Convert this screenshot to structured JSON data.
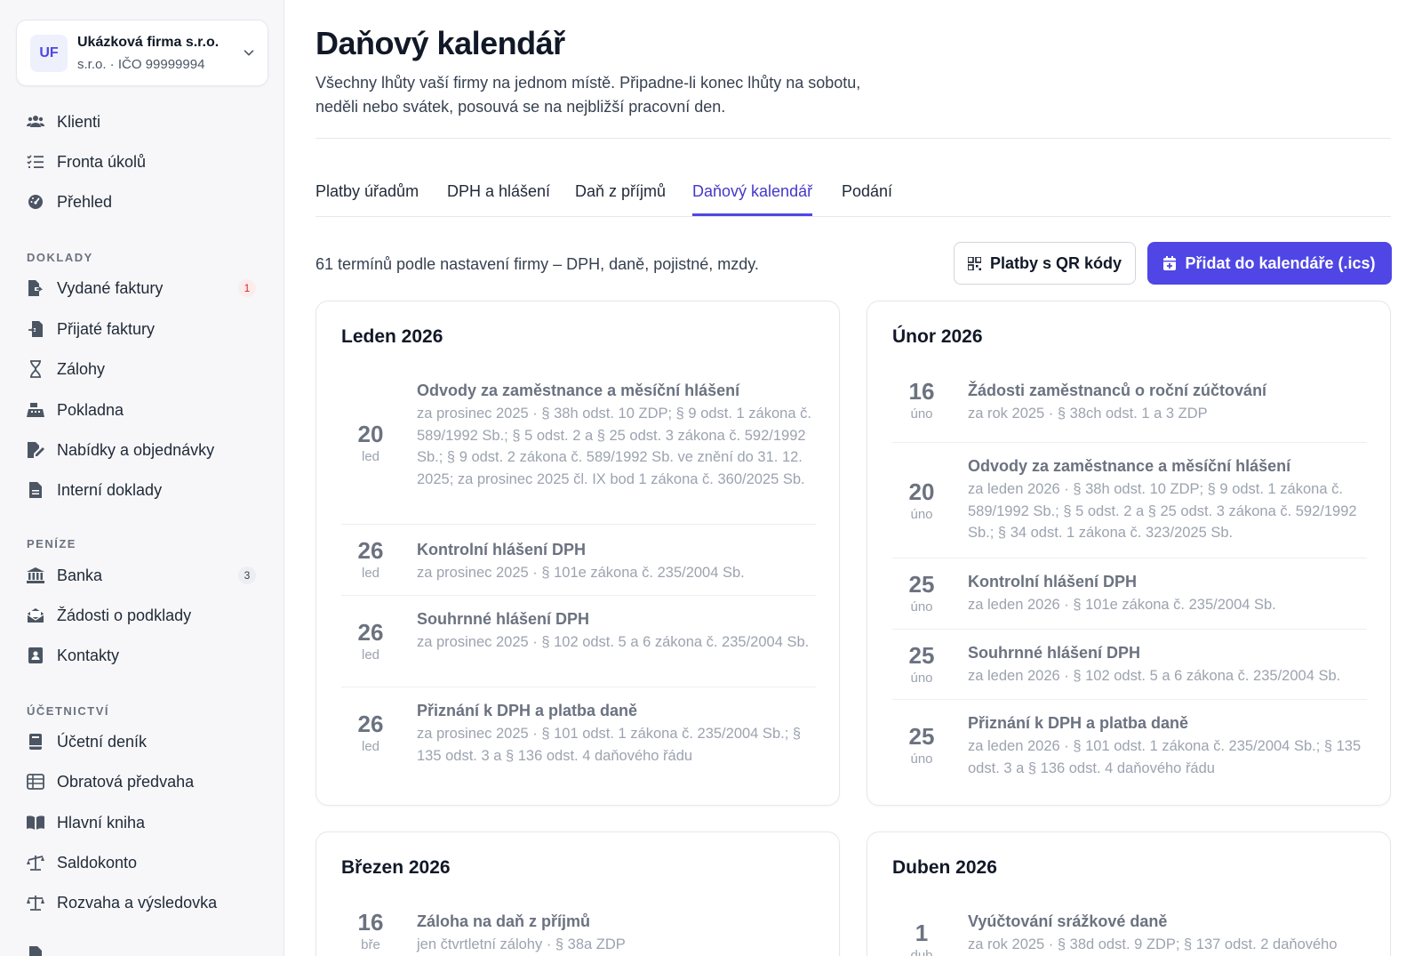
{
  "company": {
    "initials": "UF",
    "name": "Ukázková firma s.r.o.",
    "sub": "s.r.o. · IČO 99999994"
  },
  "sidebar": {
    "top_items": [
      {
        "label": "Klienti",
        "icon": "users-icon"
      },
      {
        "label": "Fronta úkolů",
        "icon": "list-check-icon"
      },
      {
        "label": "Přehled",
        "icon": "gauge-icon"
      }
    ],
    "sections": [
      {
        "title": "DOKLADY",
        "items": [
          {
            "label": "Vydané faktury",
            "icon": "invoice-out-icon",
            "badge": "1"
          },
          {
            "label": "Přijaté faktury",
            "icon": "invoice-in-icon"
          },
          {
            "label": "Zálohy",
            "icon": "hourglass-icon"
          },
          {
            "label": "Pokladna",
            "icon": "cash-register-icon"
          },
          {
            "label": "Nabídky a objednávky",
            "icon": "file-signature-icon"
          },
          {
            "label": "Interní doklady",
            "icon": "file-icon"
          }
        ]
      },
      {
        "title": "PENÍZE",
        "items": [
          {
            "label": "Banka",
            "icon": "bank-icon",
            "badge": "3"
          },
          {
            "label": "Žádosti o podklady",
            "icon": "envelope-open-icon"
          },
          {
            "label": "Kontakty",
            "icon": "contact-book-icon"
          }
        ]
      },
      {
        "title": "ÚČETNICTVÍ",
        "items": [
          {
            "label": "Účetní deník",
            "icon": "book-icon"
          },
          {
            "label": "Obratová předvaha",
            "icon": "table-icon"
          },
          {
            "label": "Hlavní kniha",
            "icon": "book-open-icon"
          },
          {
            "label": "Saldokonto",
            "icon": "scale-unbalanced-icon"
          },
          {
            "label": "Rozvaha a výsledovka",
            "icon": "scale-balanced-icon"
          }
        ]
      }
    ]
  },
  "page": {
    "title": "Daňový kalendář",
    "subtitle": "Všechny lhůty vaší firmy na jednom místě. Připadne-li konec lhůty na sobotu, neděli nebo svátek, posouvá se na nejbližší pracovní den."
  },
  "tabs": [
    {
      "label": "Platby úřadům",
      "active": false
    },
    {
      "label": "DPH a hlášení",
      "active": false
    },
    {
      "label": "Daň z příjmů",
      "active": false
    },
    {
      "label": "Daňový kalendář",
      "active": true
    },
    {
      "label": "Podání",
      "active": false
    }
  ],
  "toolbar": {
    "info": "61 termínů podle nastavení firmy – DPH, daně, pojistné, mzdy.",
    "qr_button": "Platby s QR kódy",
    "ics_button": "Přidat do kalendáře (.ics)"
  },
  "colors": {
    "accent": "#4f46e5",
    "badge_red": "#dc2626"
  },
  "months": [
    {
      "title": "Leden 2026",
      "events": [
        {
          "day": "20",
          "mon": "led",
          "title": "Odvody za zaměstnance a měsíční hlášení",
          "desc": "za prosinec 2025 · § 38h odst. 10 ZDP; § 9 odst. 1 zákona č. 589/1992 Sb.; § 5 odst. 2 a § 25 odst. 3 zákona č. 592/1992 Sb.; § 9 odst. 2 zákona č. 589/1992 Sb. ve znění do 31. 12. 2025; za prosinec 2025 čl. IX bod 1 zákona č. 360/2025 Sb."
        },
        {
          "day": "26",
          "mon": "led",
          "title": "Kontrolní hlášení DPH",
          "desc": "za prosinec 2025 · § 101e zákona č. 235/2004 Sb."
        },
        {
          "day": "26",
          "mon": "led",
          "title": "Souhrnné hlášení DPH",
          "desc": "za prosinec 2025 · § 102 odst. 5 a 6 zákona č. 235/2004 Sb."
        },
        {
          "day": "26",
          "mon": "led",
          "title": "Přiznání k DPH a platba daně",
          "desc": "za prosinec 2025 · § 101 odst. 1 zákona č. 235/2004 Sb.; § 135 odst. 3 a § 136 odst. 4 daňového řádu"
        }
      ]
    },
    {
      "title": "Únor 2026",
      "events": [
        {
          "day": "16",
          "mon": "úno",
          "title": "Žádosti zaměstnanců o roční zúčtování",
          "desc": "za rok 2025 · § 38ch odst. 1 a 3 ZDP"
        },
        {
          "day": "20",
          "mon": "úno",
          "title": "Odvody za zaměstnance a měsíční hlášení",
          "desc": "za leden 2026 · § 38h odst. 10 ZDP; § 9 odst. 1 zákona č. 589/1992 Sb.; § 5 odst. 2 a § 25 odst. 3 zákona č. 592/1992 Sb.; § 34 odst. 1 zákona č. 323/2025 Sb."
        },
        {
          "day": "25",
          "mon": "úno",
          "title": "Kontrolní hlášení DPH",
          "desc": "za leden 2026 · § 101e zákona č. 235/2004 Sb."
        },
        {
          "day": "25",
          "mon": "úno",
          "title": "Souhrnné hlášení DPH",
          "desc": "za leden 2026 · § 102 odst. 5 a 6 zákona č. 235/2004 Sb."
        },
        {
          "day": "25",
          "mon": "úno",
          "title": "Přiznání k DPH a platba daně",
          "desc": "za leden 2026 · § 101 odst. 1 zákona č. 235/2004 Sb.; § 135 odst. 3 a § 136 odst. 4 daňového řádu"
        }
      ]
    },
    {
      "title": "Březen 2026",
      "events": [
        {
          "day": "16",
          "mon": "bře",
          "title": "Záloha na daň z příjmů",
          "desc": "jen čtvrtletní zálohy · § 38a ZDP"
        }
      ]
    },
    {
      "title": "Duben 2026",
      "events": [
        {
          "day": "1",
          "mon": "dub",
          "title": "Vyúčtování srážkové daně",
          "desc": "za rok 2025 · § 38d odst. 9 ZDP; § 137 odst. 2 daňového"
        }
      ]
    }
  ]
}
